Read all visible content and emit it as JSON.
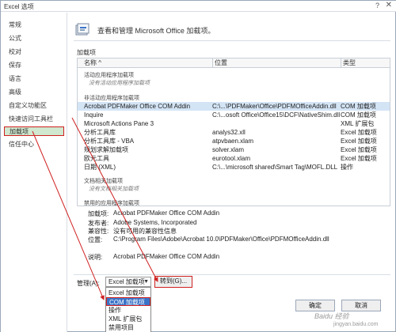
{
  "window": {
    "title": "Excel 选项",
    "help_glyph": "?",
    "close_glyph": "✕"
  },
  "sidebar": {
    "items": [
      {
        "label": "常规"
      },
      {
        "label": "公式"
      },
      {
        "label": "校对"
      },
      {
        "label": "保存"
      },
      {
        "label": "语言"
      },
      {
        "label": "高级"
      },
      {
        "label": "自定义功能区"
      },
      {
        "label": "快速访问工具栏"
      },
      {
        "label": "加载项"
      },
      {
        "label": "信任中心"
      }
    ],
    "selected_index": 8
  },
  "main": {
    "header": "查看和管理 Microsoft Office 加载项。",
    "section_label": "加载项",
    "columns": [
      "名称 ^",
      "位置",
      "类型"
    ],
    "groups": {
      "active": "活动应用程序加载项",
      "active_empty": "没有活动应用程序加载项",
      "inactive": "非活动应用程序加载项",
      "doc": "文档相关加载项",
      "doc_empty": "没有文档相关加载项",
      "disabled": "禁用的应用程序加载项"
    },
    "rows": [
      {
        "name": "Acrobat PDFMaker Office COM Addin",
        "location": "C:\\...\\PDFMaker\\Office\\PDFMOfficeAddin.dll",
        "type": "COM 加载项",
        "highlight": true
      },
      {
        "name": "Inquire",
        "location": "C:\\...osoft Office\\Office15\\DCF\\NativeShim.dll",
        "type": "COM 加载项",
        "highlight": false
      },
      {
        "name": "Microsoft Actions Pane 3",
        "location": "",
        "type": "XML 扩展包",
        "highlight": false
      },
      {
        "name": "分析工具库",
        "location": "analys32.xll",
        "type": "Excel 加载项",
        "highlight": false
      },
      {
        "name": "分析工具库 - VBA",
        "location": "atpvbaen.xlam",
        "type": "Excel 加载项",
        "highlight": false
      },
      {
        "name": "规划求解加载项",
        "location": "solver.xlam",
        "type": "Excel 加载项",
        "highlight": false
      },
      {
        "name": "欧元工具",
        "location": "eurotool.xlam",
        "type": "Excel 加载项",
        "highlight": false
      },
      {
        "name": "日期 (XML)",
        "location": "C:\\...\\microsoft shared\\Smart Tag\\MOFL.DLL",
        "type": "操作",
        "highlight": false
      }
    ]
  },
  "details": {
    "addin_label": "加载项:",
    "addin_value": "Acrobat PDFMaker Office COM Addin",
    "publisher_label": "发布者:",
    "publisher_value": "Adobe Systems, Incorporated",
    "compat_label": "兼容性:",
    "compat_value": "没有可用的兼容性信息",
    "location_label": "位置:",
    "location_value": "C:\\Program Files\\Adobe\\Acrobat 10.0\\PDFMaker\\Office\\PDFMOfficeAddin.dll",
    "desc_label": "说明:",
    "desc_value": "Acrobat PDFMaker Office COM Addin"
  },
  "manage": {
    "label": "管理(A):",
    "selected": "Excel 加载项",
    "goto_label": "转到(G)...",
    "options": [
      "Excel 加载项",
      "COM 加载项",
      "操作",
      "XML 扩展包",
      "禁用项目"
    ],
    "highlighted_index": 1
  },
  "buttons": {
    "ok": "确定",
    "cancel": "取消"
  },
  "watermark": {
    "line1": "Baidu 经验",
    "line2": "jingyan.baidu.com"
  },
  "accent": {
    "red": "#d02020",
    "selected_green": "#cfe8cf",
    "selected_blue": "#3a74c8"
  }
}
